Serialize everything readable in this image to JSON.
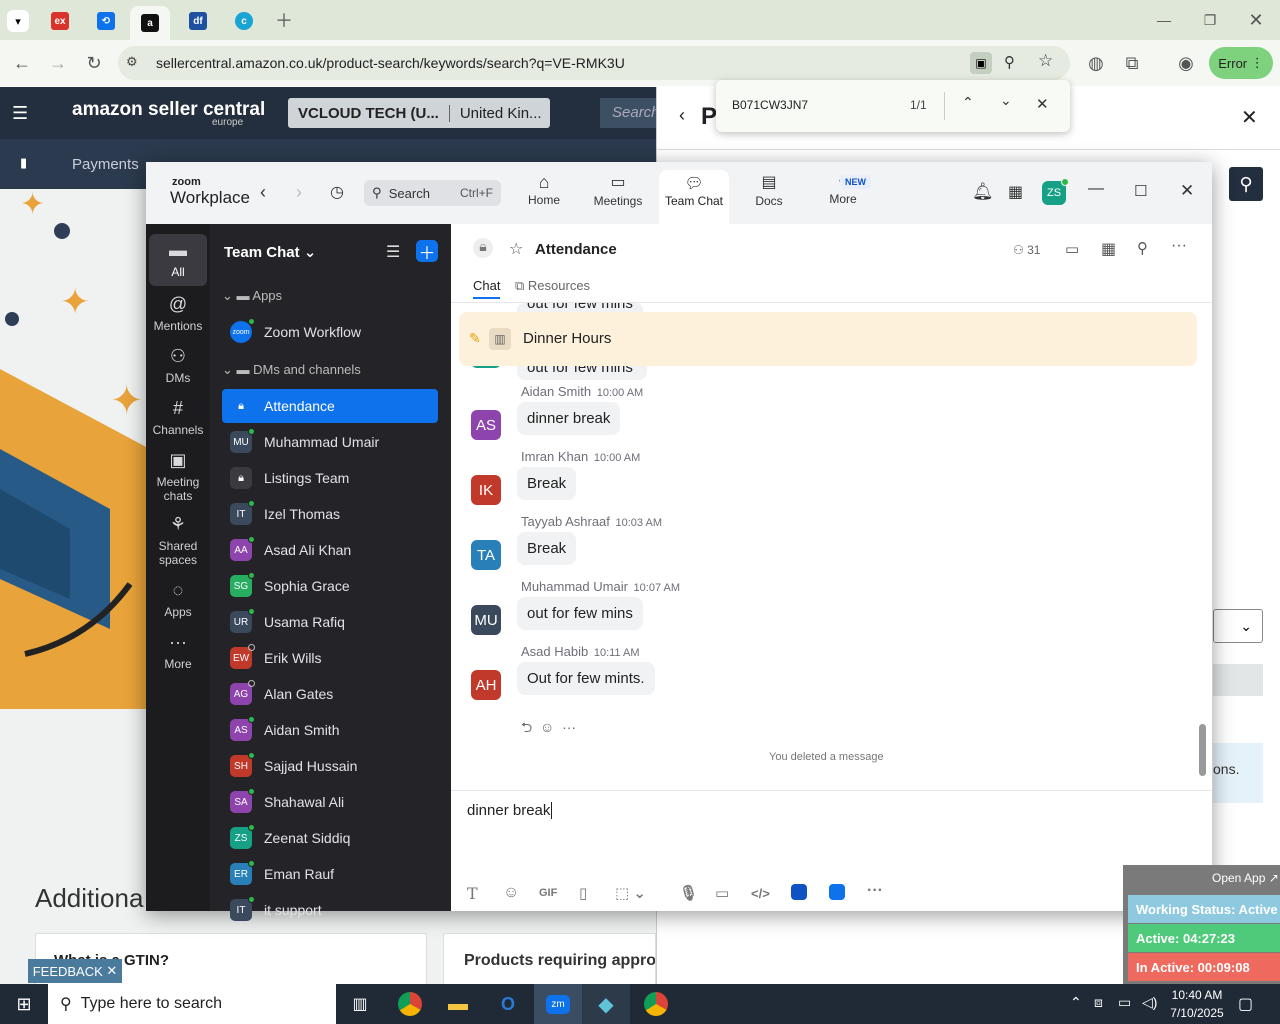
{
  "browser": {
    "address": "sellercentral.amazon.co.uk/product-search/keywords/search?q=VE-RMK3U",
    "profile_label": "Error",
    "find": {
      "query": "B071CW3JN7",
      "count": "1/1"
    }
  },
  "amazon": {
    "logo": "amazon seller central",
    "logo_sub": "europe",
    "account": "VCLOUD TECH (U...",
    "marketplace": "United Kin...",
    "search_placeholder": "Search",
    "nav_item": "Payments",
    "section_title": "Additiona",
    "card1": "What is a GTIN?",
    "card2": "Products requiring approv",
    "feedback": "FEEDBACK",
    "panel_title": "P",
    "panel_text": "ons."
  },
  "zoom": {
    "brand_top": "zoom",
    "brand": "Workplace",
    "search": {
      "label": "Search",
      "shortcut": "Ctrl+F"
    },
    "top_tabs": [
      {
        "label": "Home"
      },
      {
        "label": "Meetings"
      },
      {
        "label": "Team Chat"
      },
      {
        "label": "Docs"
      },
      {
        "label": "More",
        "badge": "NEW"
      }
    ],
    "user_initials": "ZS",
    "rail": [
      {
        "label": "All"
      },
      {
        "label": "Mentions"
      },
      {
        "label": "DMs"
      },
      {
        "label": "Channels"
      },
      {
        "label": "Meeting chats"
      },
      {
        "label": "Shared spaces"
      },
      {
        "label": "Apps"
      },
      {
        "label": "More"
      }
    ],
    "list_title": "Team Chat",
    "sections": {
      "apps": "Apps",
      "dms": "DMs and channels"
    },
    "apps": [
      {
        "name": "Zoom Workflow",
        "icon": "zoom"
      }
    ],
    "channels": [
      {
        "name": "Attendance",
        "initials": "",
        "color": "#0e72ed",
        "status": "none",
        "active": true
      },
      {
        "name": "Muhammad Umair",
        "initials": "MU",
        "color": "#3a4a5c",
        "status": "online"
      },
      {
        "name": "Listings Team",
        "initials": "",
        "color": "#3a3a40",
        "status": "none"
      },
      {
        "name": "Izel Thomas",
        "initials": "IT",
        "color": "#3a4a5c",
        "status": "online"
      },
      {
        "name": "Asad Ali Khan",
        "initials": "AA",
        "color": "#8e44ad",
        "status": "online"
      },
      {
        "name": "Sophia Grace",
        "initials": "SG",
        "color": "#27ae60",
        "status": "online"
      },
      {
        "name": "Usama Rafiq",
        "initials": "UR",
        "color": "#3a4a5c",
        "status": "online"
      },
      {
        "name": "Erik Wills",
        "initials": "EW",
        "color": "#c0392b",
        "status": "away"
      },
      {
        "name": "Alan Gates",
        "initials": "AG",
        "color": "#8e44ad",
        "status": "away"
      },
      {
        "name": "Aidan Smith",
        "initials": "AS",
        "color": "#8e44ad",
        "status": "online"
      },
      {
        "name": "Sajjad Hussain",
        "initials": "SH",
        "color": "#c0392b",
        "status": "online"
      },
      {
        "name": "Shahawal Ali",
        "initials": "SA",
        "color": "#8e44ad",
        "status": "online"
      },
      {
        "name": "Zeenat Siddiq",
        "initials": "ZS",
        "color": "#16a085",
        "status": "online"
      },
      {
        "name": "Eman Rauf",
        "initials": "ER",
        "color": "#2980b9",
        "status": "online"
      },
      {
        "name": "it support",
        "initials": "IT",
        "color": "#3a4a5c",
        "status": "online"
      }
    ],
    "channel": {
      "name": "Attendance",
      "members": "31",
      "tabs": [
        "Chat",
        "Resources"
      ],
      "pinned": "Dinner Hours",
      "partial_top": "out for few mins",
      "partial_second": "out for few mins",
      "messages": [
        {
          "initials": "AS",
          "color": "#8e44ad",
          "author": "Aidan Smith",
          "time": "10:00 AM",
          "text": "dinner break"
        },
        {
          "initials": "IK",
          "color": "#c0392b",
          "author": "Imran Khan",
          "time": "10:00 AM",
          "text": "Break"
        },
        {
          "initials": "TA",
          "color": "#2980b9",
          "author": "Tayyab Ashraaf",
          "time": "10:03 AM",
          "text": "Break"
        },
        {
          "initials": "MU",
          "color": "#3a4a5c",
          "author": "Muhammad Umair",
          "time": "10:07 AM",
          "text": "out for few mins"
        },
        {
          "initials": "AH",
          "color": "#c0392b",
          "author": "Asad Habib",
          "time": "10:11 AM",
          "text": "Out for few mints."
        }
      ],
      "system_note": "You deleted a message",
      "composer_text": "dinner break",
      "toolbar": [
        "T",
        "☺",
        "GIF",
        "file",
        "screenshot",
        "mic",
        "video",
        "code",
        "app1",
        "app2",
        "more"
      ]
    }
  },
  "widget": {
    "open_app": "Open App ↗",
    "working_status": "Working Status: Active",
    "active": "Active: 04:27:23",
    "inactive": "In Active: 00:09:08"
  },
  "taskbar": {
    "search_placeholder": "Type here to search",
    "time": "10:40 AM",
    "date": "7/10/2025"
  }
}
